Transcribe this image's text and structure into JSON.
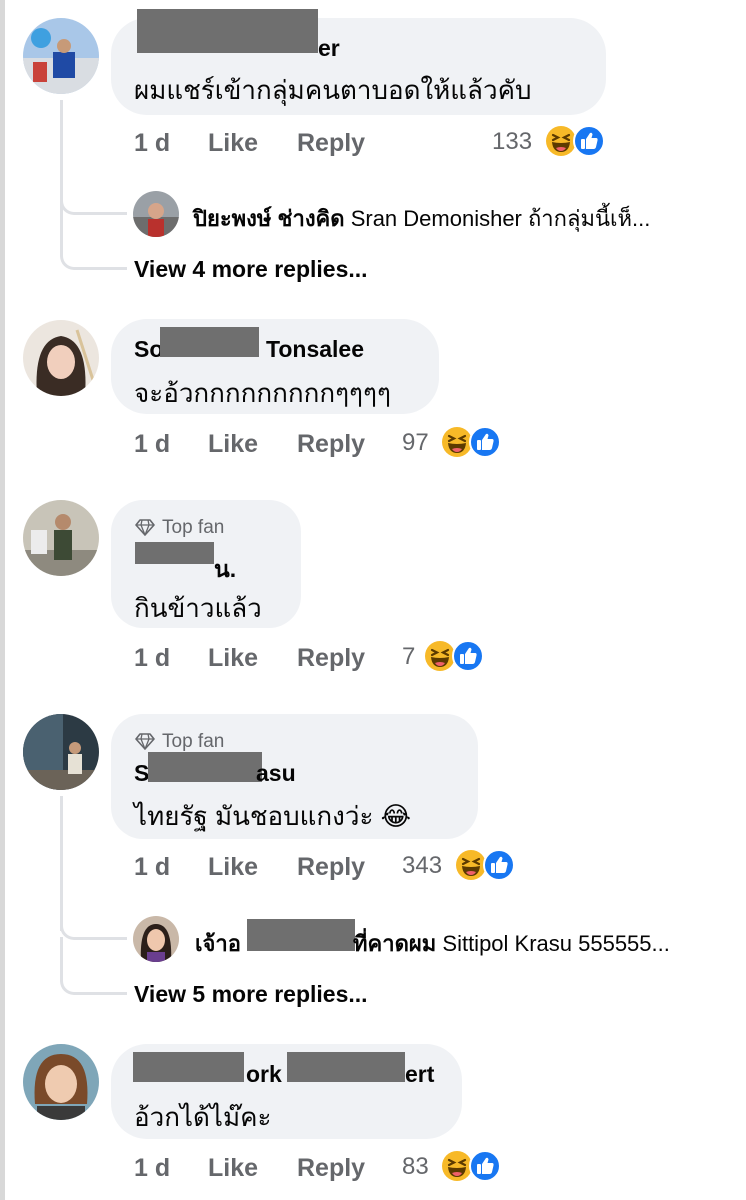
{
  "actions": {
    "like": "Like",
    "reply": "Reply"
  },
  "comments": [
    {
      "name_visible": "er",
      "text": "ผมแชร์เข้ากลุ่มคนตาบอดให้แล้วคับ",
      "time": "1 d",
      "reaction_count": "133",
      "reply_preview": {
        "author": "ปิยะพงษ์ ช่างคิด",
        "snippet": "Sran Demonisher ถ้ากลุ่มนี้เห็..."
      },
      "more_replies": "View 4 more replies..."
    },
    {
      "name_start": "So",
      "name_end": "Tonsalee",
      "text": "จะอ้วกกกกกกกกกๆๆๆๆ",
      "time": "1 d",
      "reaction_count": "97"
    },
    {
      "badge": "Top fan",
      "name_visible": "น.",
      "text": "กินข้าวแล้ว",
      "time": "1 d",
      "reaction_count": "7"
    },
    {
      "badge": "Top fan",
      "name_start": "S",
      "name_end": "asu",
      "text": "ไทยรัฐ มันชอบแกงว่ะ 😂",
      "time": "1 d",
      "reaction_count": "343",
      "reply_preview": {
        "author_start": "เจ้าอ",
        "author_end": "ที่คาดผม",
        "snippet": "Sittipol Krasu 555555..."
      },
      "more_replies": "View 5 more replies..."
    },
    {
      "name_mid": "ork",
      "name_end": "ert",
      "text": "อ้วกได้ไม๊คะ",
      "time": "1 d",
      "reaction_count": "83"
    }
  ],
  "icons": {
    "haha": "laughing-face-emoji",
    "like": "thumbs-up",
    "badge": "diamond"
  },
  "colors": {
    "bubble": "#f0f2f5",
    "like_blue": "#1877f2",
    "haha_yellow": "#f7b928",
    "muted": "#65676b"
  }
}
